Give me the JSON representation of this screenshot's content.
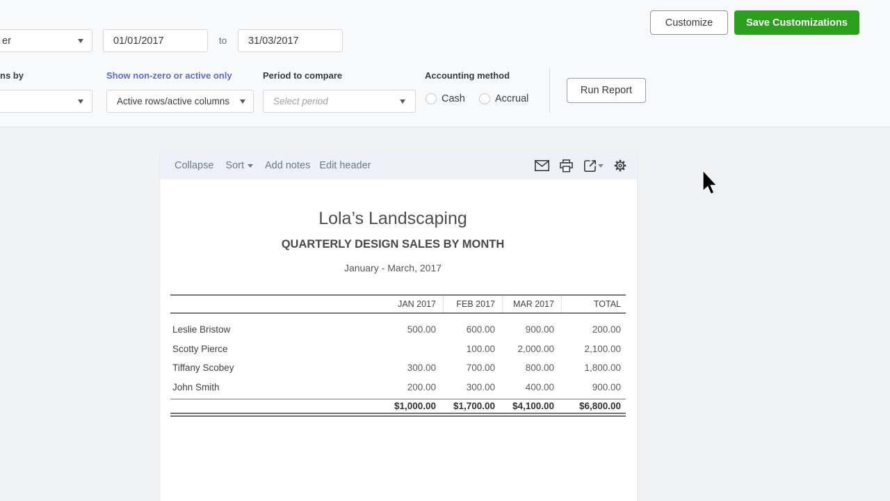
{
  "filters": {
    "period_fragment": "er",
    "date_from": "01/01/2017",
    "to_label": "to",
    "date_to": "31/03/2017",
    "columns_by_fragment": "ns by",
    "nonzero_link": "Show non-zero or active only",
    "rows_columns_value": "Active rows/active columns",
    "period_compare_label": "Period to compare",
    "period_placeholder": "Select period",
    "accounting_label": "Accounting method",
    "cash": "Cash",
    "accrual": "Accrual",
    "run_report": "Run Report"
  },
  "actions": {
    "customize": "Customize",
    "save": "Save Customizations"
  },
  "toolbar": {
    "collapse": "Collapse",
    "sort": "Sort",
    "add_notes": "Add notes",
    "edit_header": "Edit header",
    "icons": [
      "email-icon",
      "print-icon",
      "export-icon",
      "settings-icon"
    ]
  },
  "report": {
    "company": "Lola’s Landscaping",
    "title": "QUARTERLY DESIGN SALES BY MONTH",
    "period": "January - March, 2017",
    "table": {
      "columns": [
        "",
        "JAN 2017",
        "FEB 2017",
        "MAR 2017",
        "TOTAL"
      ],
      "rows": [
        {
          "name": "Leslie Bristow",
          "values": [
            "500.00",
            "600.00",
            "900.00",
            "200.00"
          ]
        },
        {
          "name": "Scotty Pierce",
          "values": [
            "",
            "100.00",
            "2,000.00",
            "2,100.00"
          ]
        },
        {
          "name": "Tiffany Scobey",
          "values": [
            "300.00",
            "700.00",
            "800.00",
            "1,800.00"
          ]
        },
        {
          "name": "John Smith",
          "values": [
            "200.00",
            "300.00",
            "400.00",
            "900.00"
          ]
        }
      ],
      "totals": [
        "$1,000.00",
        "$1,700.00",
        "$4,100.00",
        "$6,800.00"
      ]
    }
  },
  "colors": {
    "accent_green": "#2ca01c",
    "link_blue": "#5b6bd1",
    "toolbar_link": "#6d7a8f",
    "card_toolbar_bg": "#eef1f7"
  }
}
